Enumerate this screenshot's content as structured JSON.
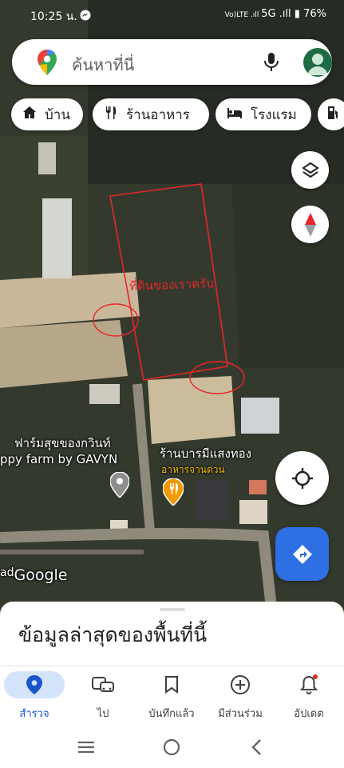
{
  "status_bar": {
    "time": "10:25 น.",
    "signal_text": "5G",
    "battery": "76%"
  },
  "search": {
    "placeholder": "ค้นหาที่นี่"
  },
  "chips": [
    {
      "label": "บ้าน",
      "icon": "home-icon"
    },
    {
      "label": "ร้านอาหาร",
      "icon": "restaurant-icon"
    },
    {
      "label": "โรงแรม",
      "icon": "hotel-icon"
    }
  ],
  "map": {
    "annotation": "ที่ดินของเราครับ",
    "place1_line1": "ฟาร์มสุขของกวินท์",
    "place1_line2": "ppy farm by GAVYN",
    "place2_name": "ร้านบารมีแสงทอง",
    "place2_category": "อาหารจานด่วน",
    "google_prefix": "ad",
    "google_logo": "Google"
  },
  "sheet": {
    "title": "ข้อมูลล่าสุดของพื้นที่นี้"
  },
  "bottom_nav": [
    {
      "label": "สำรวจ",
      "icon": "explore-pin-icon",
      "active": true
    },
    {
      "label": "ไป",
      "icon": "commute-icon",
      "active": false
    },
    {
      "label": "บันทึกแล้ว",
      "icon": "bookmark-icon",
      "active": false
    },
    {
      "label": "มีส่วนร่วม",
      "icon": "add-circle-icon",
      "active": false
    },
    {
      "label": "อัปเดต",
      "icon": "notifications-icon",
      "active": false
    }
  ],
  "colors": {
    "accent": "#1a73e8",
    "annotation": "#e8252b",
    "directions": "#2f6fe4"
  }
}
